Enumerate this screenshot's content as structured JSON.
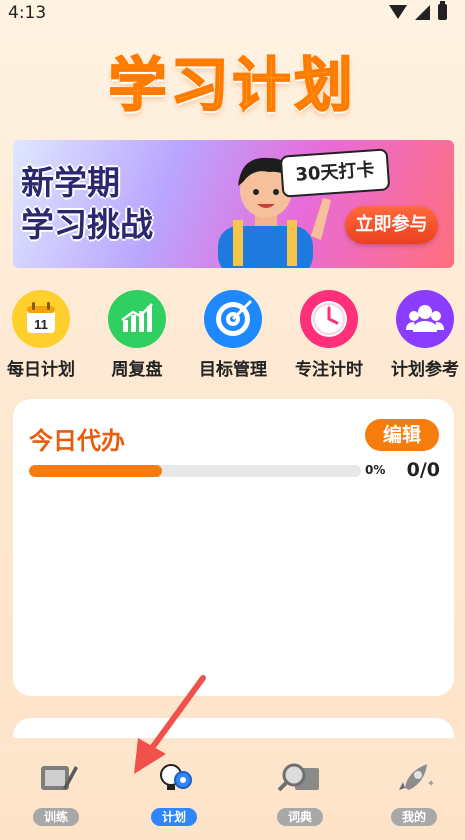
{
  "status_bar": {
    "time": "4:13"
  },
  "header": {
    "title": "学习计划"
  },
  "banner": {
    "line1": "新学期",
    "line2": "学习挑战",
    "sign": "30天打卡",
    "cta": "立即参与"
  },
  "quick_nav": [
    {
      "label": "每日计划",
      "icon": "calendar-icon",
      "color": "#ffcf2e",
      "badge": "11"
    },
    {
      "label": "周复盘",
      "icon": "bar-chart-icon",
      "color": "#2fcf62"
    },
    {
      "label": "目标管理",
      "icon": "target-icon",
      "color": "#1e88ff"
    },
    {
      "label": "专注计时",
      "icon": "clock-icon",
      "color": "#ff2f7a"
    },
    {
      "label": "计划参考",
      "icon": "users-icon",
      "color": "#8a3cff"
    }
  ],
  "todo_card": {
    "title": "今日代办",
    "edit_label": "编辑",
    "progress_percent": 0,
    "progress_text": "0%",
    "count_text": "0/0"
  },
  "bottom_nav": [
    {
      "label": "训练",
      "icon": "notebook-pen-icon",
      "active": false
    },
    {
      "label": "计划",
      "icon": "lightbulb-gear-icon",
      "active": true
    },
    {
      "label": "词典",
      "icon": "magnifier-book-icon",
      "active": false
    },
    {
      "label": "我的",
      "icon": "rocket-icon",
      "active": false
    }
  ],
  "colors": {
    "accent": "#f57c0d",
    "title": "#e85d0c",
    "active_tab": "#2f86ff"
  }
}
